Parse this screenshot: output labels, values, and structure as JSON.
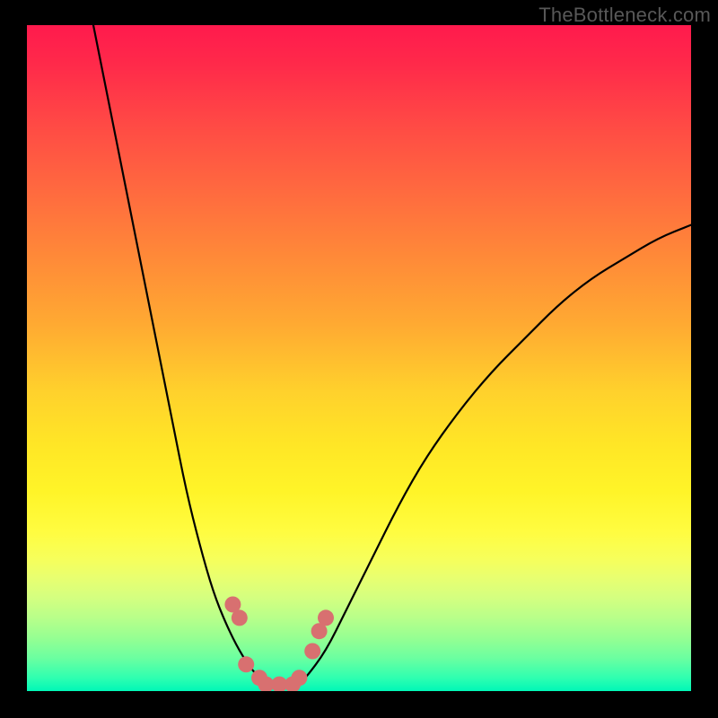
{
  "watermark": "TheBottleneck.com",
  "colors": {
    "frame_background": "#000000",
    "gradient_top": "#ff1a4d",
    "gradient_mid": "#ffe626",
    "gradient_bottom": "#00f7b7",
    "curve_stroke": "#000000",
    "marker_fill": "#d87070",
    "watermark_text": "#585858"
  },
  "chart_data": {
    "type": "line",
    "title": "",
    "xlabel": "",
    "ylabel": "",
    "xlim": [
      0,
      100
    ],
    "ylim": [
      0,
      100
    ],
    "grid": false,
    "legend": false,
    "note": "Background vertical color gradient encodes y-value: red≈100, yellow≈50, green≈0. V-shaped curve with minimum near x≈35-40 at y≈0; right branch asymptotically approaches y≈70.",
    "series": [
      {
        "name": "left-branch",
        "x": [
          10,
          12,
          14,
          16,
          18,
          20,
          22,
          24,
          26,
          28,
          30,
          32,
          34,
          36,
          38
        ],
        "y": [
          100,
          90,
          80,
          70,
          60,
          50,
          40,
          30,
          22,
          15,
          10,
          6,
          3,
          1,
          0
        ]
      },
      {
        "name": "right-branch",
        "x": [
          40,
          42,
          45,
          48,
          52,
          56,
          60,
          65,
          70,
          75,
          80,
          85,
          90,
          95,
          100
        ],
        "y": [
          0,
          2,
          6,
          12,
          20,
          28,
          35,
          42,
          48,
          53,
          58,
          62,
          65,
          68,
          70
        ]
      }
    ],
    "markers": {
      "name": "floor-markers",
      "note": "rounded salmon markers near bottom of V",
      "points": [
        {
          "x": 31,
          "y": 13
        },
        {
          "x": 32,
          "y": 11
        },
        {
          "x": 33,
          "y": 4
        },
        {
          "x": 35,
          "y": 2
        },
        {
          "x": 36,
          "y": 1
        },
        {
          "x": 38,
          "y": 1
        },
        {
          "x": 40,
          "y": 1
        },
        {
          "x": 41,
          "y": 2
        },
        {
          "x": 43,
          "y": 6
        },
        {
          "x": 44,
          "y": 9
        },
        {
          "x": 45,
          "y": 11
        }
      ]
    }
  }
}
